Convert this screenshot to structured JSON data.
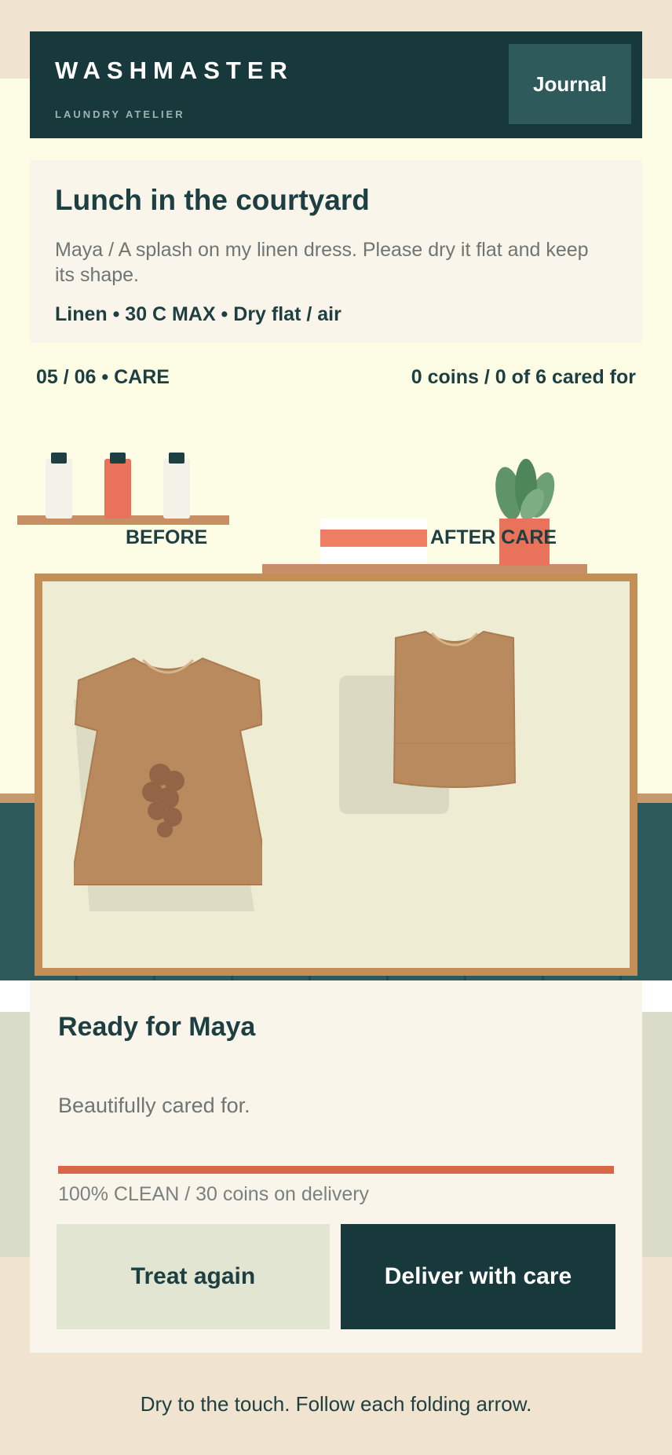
{
  "header": {
    "brand": "WASHMASTER",
    "subtitle": "LAUNDRY ATELIER",
    "journal_label": "Journal"
  },
  "order": {
    "title": "Lunch in the courtyard",
    "description": "Maya  /  A splash on my linen dress. Please dry it flat and keep its shape.",
    "tags": "Linen  •  30 C MAX  •  Dry flat / air"
  },
  "status": {
    "left": "05 / 06  •  CARE",
    "right": "0 coins  /  0 of 6 cared for"
  },
  "scene": {
    "label_before": "BEFORE",
    "label_after": "AFTER CARE"
  },
  "result": {
    "title": "Ready for Maya",
    "message": "Beautifully cared for.",
    "clean_progress": 1.0,
    "progress_text": "100% CLEAN  /  30 coins on delivery",
    "treat_again_label": "Treat again",
    "deliver_label": "Deliver with care"
  },
  "footer": {
    "hint": "Dry to the touch. Follow each folding arrow."
  },
  "colors": {
    "primary": "#17393b",
    "accent": "#d9654a",
    "cream": "#faf5ea",
    "garment": "#b88a5e"
  }
}
